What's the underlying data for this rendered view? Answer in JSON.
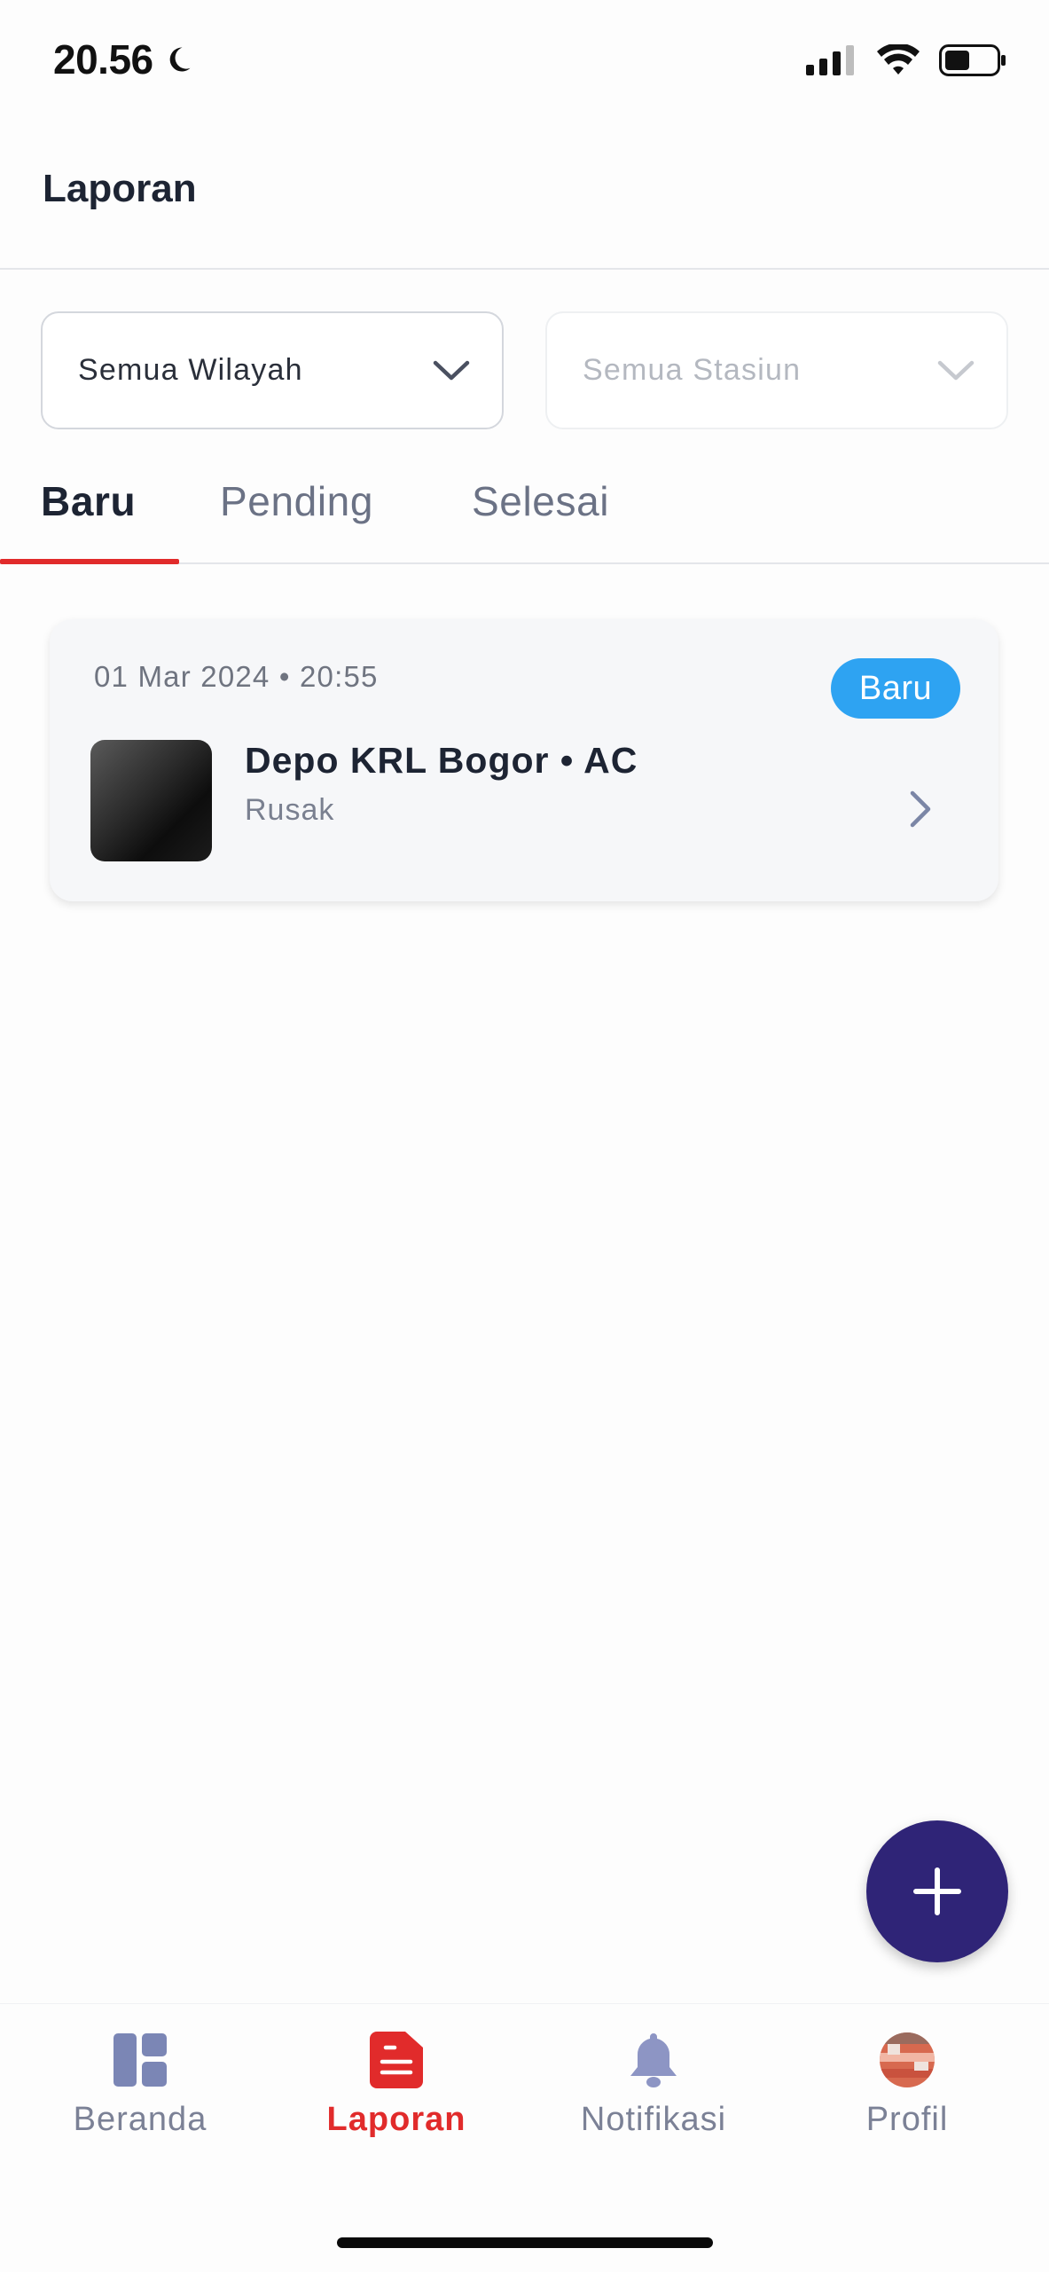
{
  "status_bar": {
    "time": "20.56",
    "icons": [
      "moon-icon",
      "cellular-signal-icon",
      "wifi-icon",
      "battery-icon"
    ]
  },
  "header": {
    "title": "Laporan"
  },
  "filters": {
    "region": {
      "value": "Semua Wilayah"
    },
    "station": {
      "placeholder": "Semua Stasiun"
    }
  },
  "tabs": [
    {
      "label": "Baru",
      "active": true
    },
    {
      "label": "Pending",
      "active": false
    },
    {
      "label": "Selesai",
      "active": false
    }
  ],
  "reports": [
    {
      "datetime": "01 Mar 2024 • 20:55",
      "badge": "Baru",
      "title": "Depo KRL Bogor • AC",
      "status": "Rusak"
    }
  ],
  "fab": {
    "icon": "plus-icon"
  },
  "bottom_nav": [
    {
      "label": "Beranda",
      "icon": "dashboard-icon",
      "active": false
    },
    {
      "label": "Laporan",
      "icon": "report-icon",
      "active": true
    },
    {
      "label": "Notifikasi",
      "icon": "bell-icon",
      "active": false
    },
    {
      "label": "Profil",
      "icon": "avatar",
      "active": false
    }
  ],
  "colors": {
    "accent_red": "#e12b2b",
    "badge_blue": "#2ea3f2",
    "fab_navy": "#2f2477",
    "nav_inactive": "#7b8196"
  }
}
